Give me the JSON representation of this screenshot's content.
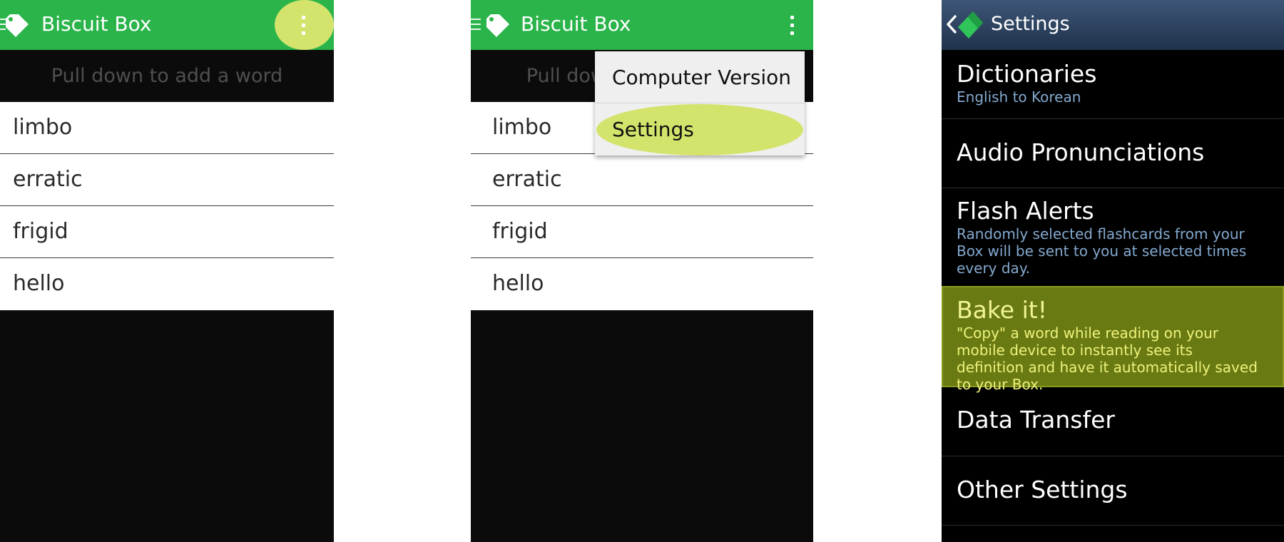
{
  "screen1": {
    "app_title": "Biscuit Box",
    "pull_hint": "Pull down to add a word",
    "words": [
      "limbo",
      "erratic",
      "frigid",
      "hello"
    ],
    "overflow_icon": "overflow-menu-icon",
    "highlight_color": "#d3e36b"
  },
  "screen2": {
    "app_title": "Biscuit Box",
    "pull_hint": "Pull down to add a word",
    "words": [
      "limbo",
      "erratic",
      "frigid",
      "hello"
    ],
    "menu": [
      "Computer Version",
      "Settings"
    ],
    "highlight_color": "#d3e36b"
  },
  "screen3": {
    "title": "Settings",
    "items": [
      {
        "title": "Dictionaries",
        "subtitle": "English to Korean"
      },
      {
        "title": "Audio Pronunciations",
        "subtitle": ""
      },
      {
        "title": "Flash Alerts",
        "subtitle": "Randomly selected flashcards from your Box will be sent to you at selected times every day."
      },
      {
        "title": "Bake it!",
        "subtitle": "\"Copy\" a word while reading on your mobile device to instantly see its definition and have it automatically saved to your Box."
      },
      {
        "title": "Data Transfer",
        "subtitle": ""
      },
      {
        "title": "Other Settings",
        "subtitle": ""
      }
    ]
  },
  "colors": {
    "action_bar": "#2ab44a",
    "highlight": "#d3e36b",
    "settings_highlight": "#6a7a13",
    "subtitle": "#84a9cf"
  }
}
